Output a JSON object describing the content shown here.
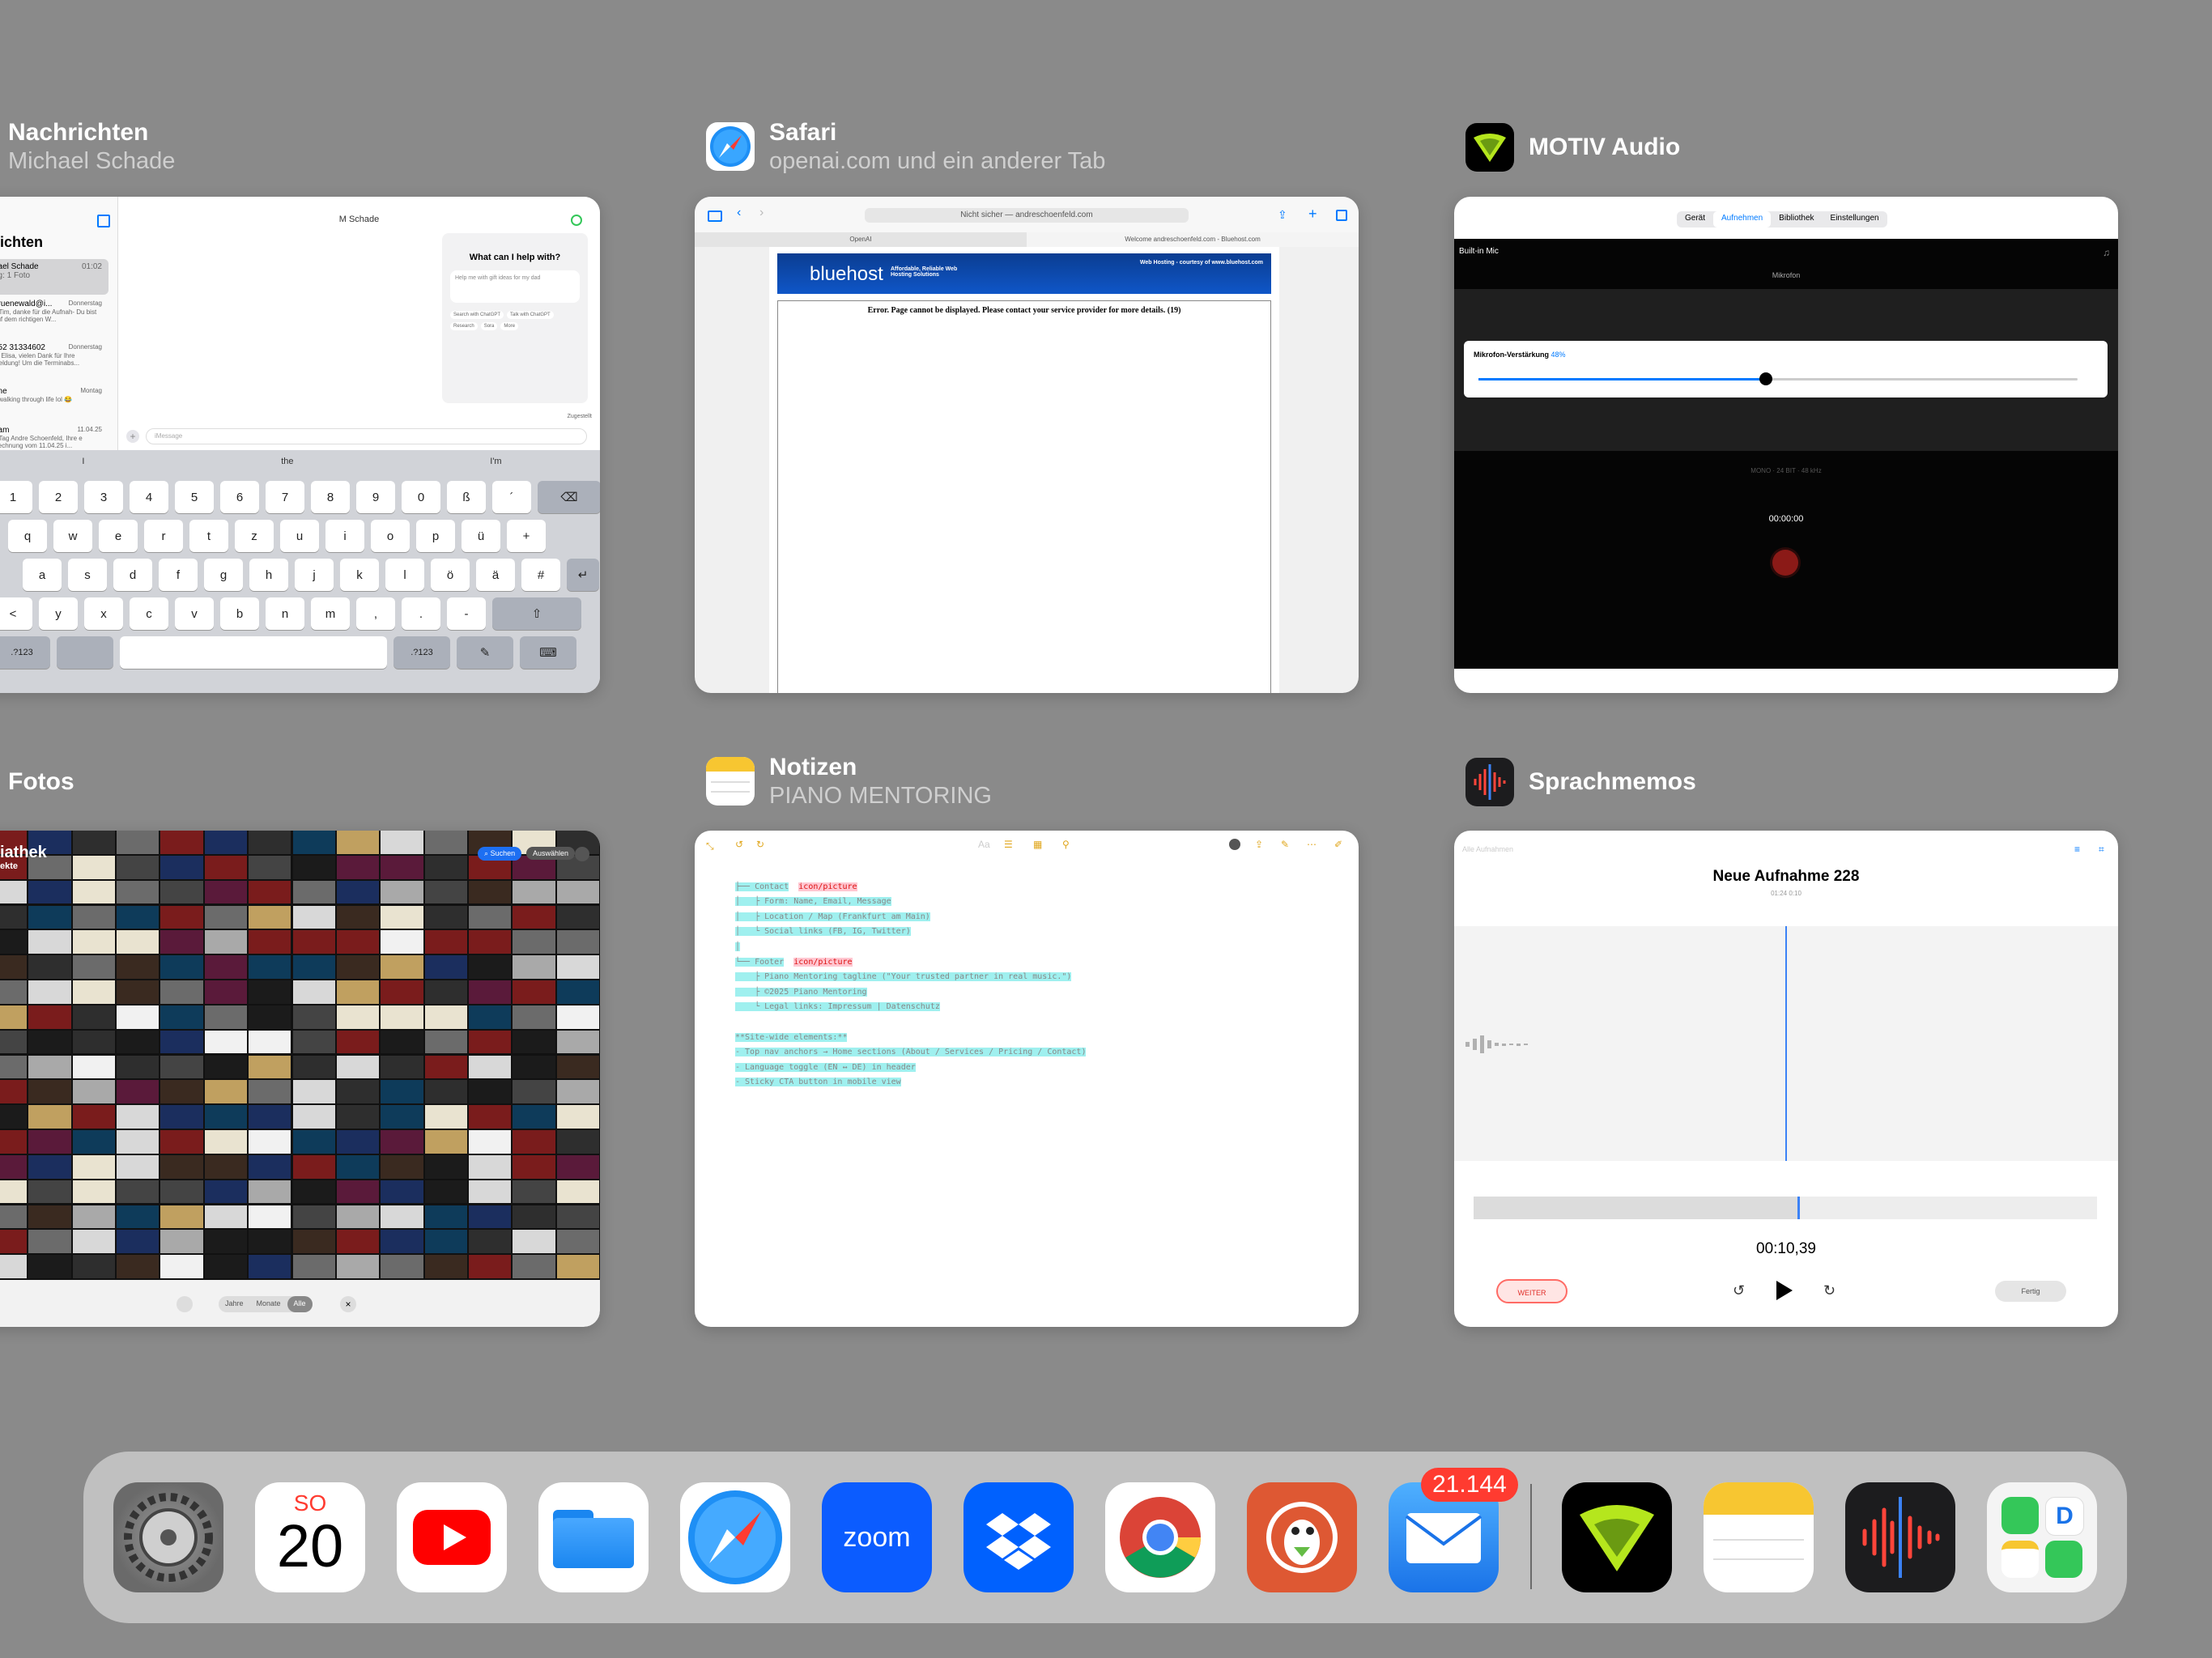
{
  "apps": {
    "messages": {
      "title": "Nachrichten",
      "subtitle": "Michael Schade"
    },
    "safari": {
      "title": "Safari",
      "subtitle": "openai.com und ein anderer Tab"
    },
    "motiv": {
      "title": "MOTIV Audio"
    },
    "photos": {
      "title": "Fotos"
    },
    "notes": {
      "title": "Notizen",
      "subtitle": "PIANO MENTORING"
    },
    "voicememos": {
      "title": "Sprachmemos"
    }
  },
  "messages_card": {
    "sidebar_title": "ichten",
    "conversation_title": "M Schade",
    "threads": [
      {
        "name": "hael Schade",
        "time": "01:02",
        "preview": "ng: 1 Foto"
      },
      {
        "name": "gruenewald@i...",
        "time": "Donnerstag",
        "preview": "e Tim, danke für die Aufnah- Du bist auf dem richtigen W..."
      },
      {
        "name": "152 31334602",
        "time": "Donnerstag",
        "preview": "er Elisa, vielen Dank für Ihre meldung! Um die Terminabs..."
      },
      {
        "name": "one",
        "time": "Montag",
        "preview": "y walking through life lol 😂"
      },
      {
        "name": "eam",
        "time": "11.04.25",
        "preview": "n Tag Andre Schoenfeld, Ihre e Rechnung vom 11.04.25 i..."
      }
    ],
    "chat_heading": "What can I help with?",
    "chat_prompt": "Help me with gift ideas for my dad",
    "chat_chips": [
      "Search with ChatGPT",
      "Talk with ChatGPT",
      "Research",
      "Sora",
      "More"
    ],
    "delivered": "Zugestellt",
    "message_placeholder": "iMessage",
    "suggestions": [
      "I",
      "the",
      "I'm"
    ],
    "kb_row1": [
      "1",
      "2",
      "3",
      "4",
      "5",
      "6",
      "7",
      "8",
      "9",
      "0",
      "ß",
      "´"
    ],
    "kb_row2": [
      "q",
      "w",
      "e",
      "r",
      "t",
      "z",
      "u",
      "i",
      "o",
      "p",
      "ü",
      "+"
    ],
    "kb_row3": [
      "a",
      "s",
      "d",
      "f",
      "g",
      "h",
      "j",
      "k",
      "l",
      "ö",
      "ä",
      "#"
    ],
    "kb_row4": [
      "<",
      "y",
      "x",
      "c",
      "v",
      "b",
      "n",
      "m",
      ",",
      ".",
      "-"
    ],
    "kb_num": ".?123"
  },
  "safari_card": {
    "url": "Nicht sicher — andreschoenfeld.com",
    "tabs": [
      "OpenAI",
      "Welcome andreschoenfeld.com - Bluehost.com"
    ],
    "banner_brand": "bluehost",
    "banner_tagline": "Affordable, Reliable Web Hosting Solutions",
    "banner_right": "Web Hosting - courtesy of www.bluehost.com",
    "error_text": "Error. Page cannot be displayed. Please contact your service provider for more details. (19)"
  },
  "motiv_card": {
    "tabs": [
      "Gerät",
      "Aufnehmen",
      "Bibliothek",
      "Einstellungen"
    ],
    "active_tab": "Aufnehmen",
    "input": "Built-in Mic",
    "mic_label": "Mikrofon",
    "gain_label": "Mikrofon-Verstärkung",
    "gain_value": "48%",
    "gain_fraction": 0.48,
    "mode_text": "MONO · 24 BIT · 48 kHz",
    "time": "00:00:00"
  },
  "photos_card": {
    "header": "iathek",
    "header_sub": "ekte",
    "search_btn": "Suchen",
    "select_btn": "Auswählen",
    "filters": [
      "Jahre",
      "Monate",
      "Alle"
    ],
    "active_filter": "Alle"
  },
  "notes_card": {
    "lines": [
      "├── Contact",
      "│   ├ Form: Name, Email, Message",
      "│   ├ Location / Map (Frankfurt am Main)",
      "│   └ Social links (FB, IG, Twitter)",
      "│",
      "└── Footer",
      "    ├ Piano Mentoring tagline (\"Your trusted partner in real music.\")",
      "    ├ ©2025 Piano Mentoring",
      "    └ Legal links: Impressum | Datenschutz",
      "",
      "**Site-wide elements:**",
      "- Top nav anchors → Home sections (About / Services / Pricing / Contact)",
      "- Language toggle (EN ↔ DE) in header",
      "- Sticky CTA button in mobile view"
    ],
    "tag": "icon/picture"
  },
  "voicememos_card": {
    "back": "Alle Aufnahmen",
    "title": "Neue Aufnahme 228",
    "subtitle": "01:24  0:10",
    "time": "00:10,39",
    "resume": "WEITER",
    "done": "Fertig"
  },
  "dock": {
    "calendar_day": "SO",
    "calendar_date": "20",
    "zoom_label": "zoom",
    "mail_badge": "21.144",
    "icons": [
      "settings-icon",
      "calendar-icon",
      "youtube-icon",
      "files-icon",
      "safari-icon",
      "zoom-icon",
      "dropbox-icon",
      "chrome-icon",
      "duckduckgo-icon",
      "mail-icon",
      "motiv-audio-icon",
      "notes-icon",
      "voice-memos-icon",
      "app-library-icon"
    ]
  },
  "colors": {
    "background": "#8a8a8a",
    "accent": "#007aff",
    "record": "#e0302b",
    "notes_highlight": "#9ff0ef",
    "badge": "#ff3b30"
  }
}
